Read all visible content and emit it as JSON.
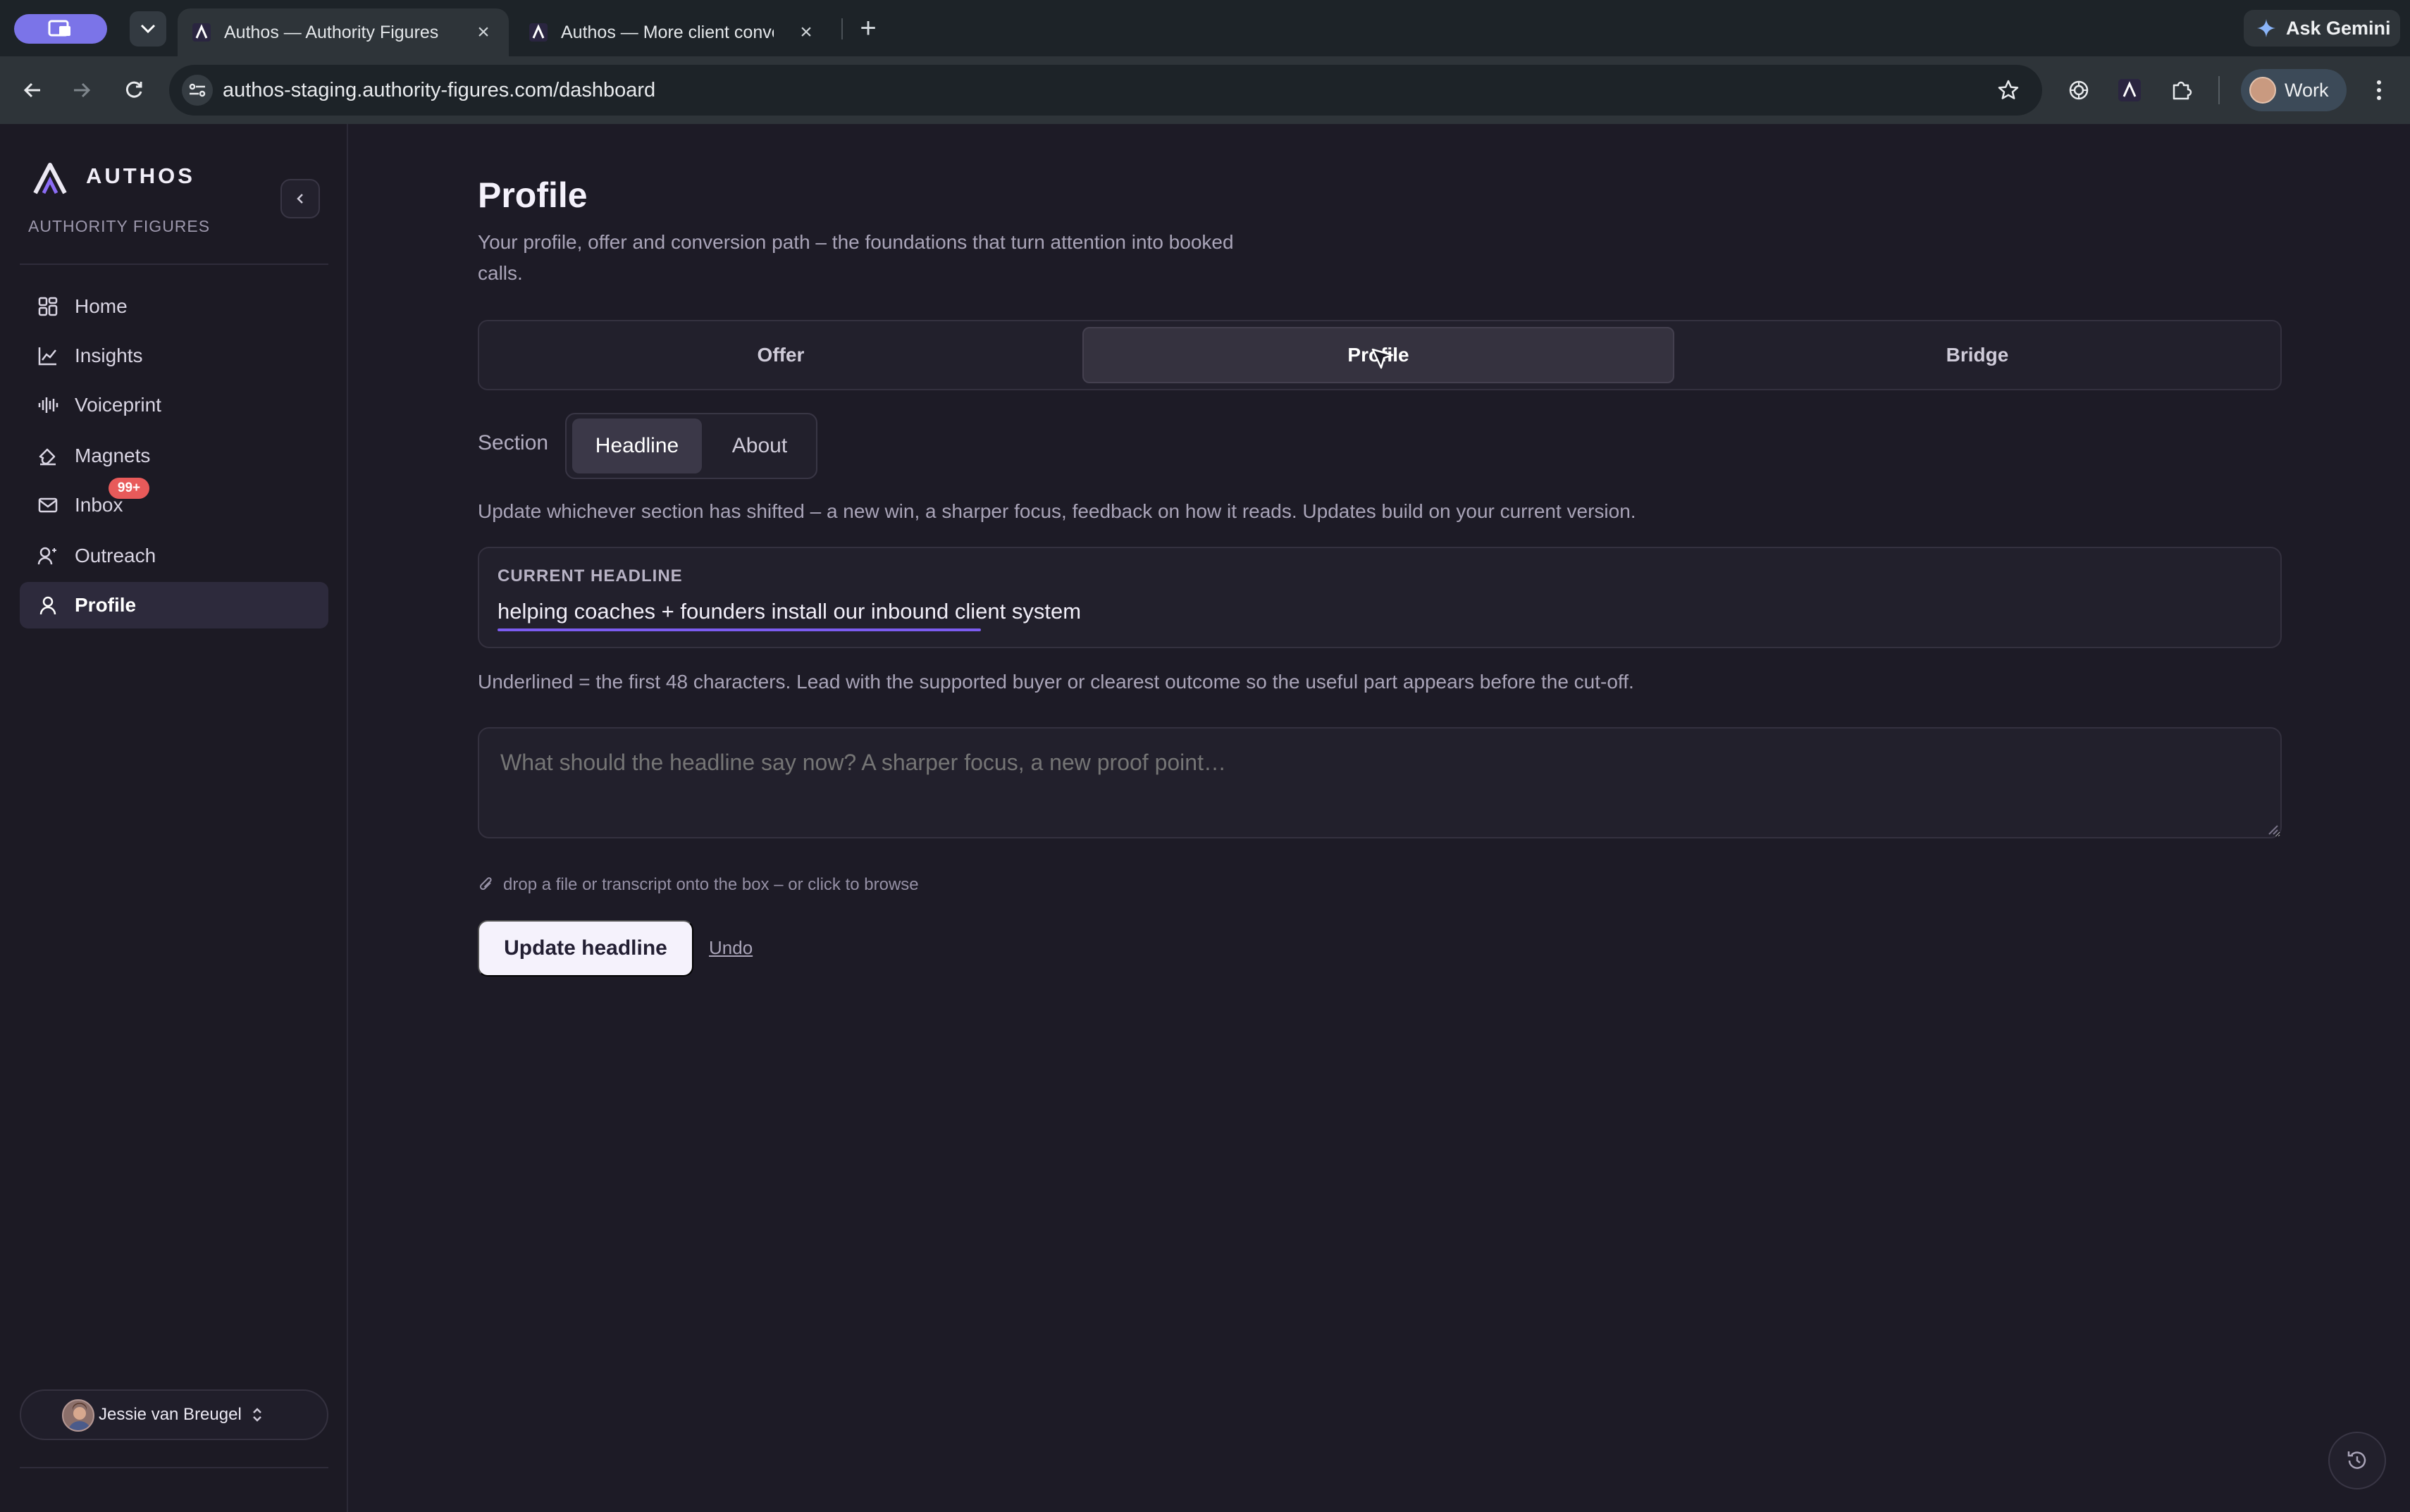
{
  "browser": {
    "tabs": [
      {
        "title": "Authos — Authority Figures",
        "active": true
      },
      {
        "title": "Authos — More client convers",
        "active": false
      }
    ],
    "new_tab": "+",
    "ask_gemini": "Ask Gemini",
    "url": "authos-staging.authority-figures.com/dashboard",
    "profile_label": "Work"
  },
  "sidebar": {
    "brand": "AUTHOS",
    "workspace": "AUTHORITY FIGURES",
    "items": [
      {
        "label": "Home",
        "icon": "grid-icon"
      },
      {
        "label": "Insights",
        "icon": "chart-line-icon"
      },
      {
        "label": "Voiceprint",
        "icon": "waveform-icon"
      },
      {
        "label": "Magnets",
        "icon": "magnet-icon"
      },
      {
        "label": "Inbox",
        "icon": "mail-icon",
        "badge": "99+"
      },
      {
        "label": "Outreach",
        "icon": "user-plus-icon"
      },
      {
        "label": "Profile",
        "icon": "user-icon",
        "active": true
      }
    ],
    "user": "Jessie van Breugel"
  },
  "main": {
    "title": "Profile",
    "subtitle": "Your profile, offer and conversion path – the foundations that turn attention into booked calls.",
    "tabs": [
      {
        "label": "Offer"
      },
      {
        "label": "Profile",
        "active": true
      },
      {
        "label": "Bridge"
      }
    ],
    "section_label": "Section",
    "sections": [
      {
        "label": "Headline",
        "active": true
      },
      {
        "label": "About"
      }
    ],
    "help": "Update whichever section has shifted – a new win, a sharper focus, feedback on how it reads. Updates build on your current version.",
    "current_label": "CURRENT HEADLINE",
    "current_value": "helping coaches + founders install our inbound client system",
    "note": "Underlined = the first 48 characters. Lead with the supported buyer or clearest outcome so the useful part appears before the cut-off.",
    "input_placeholder": "What should the headline say now? A sharper focus, a new proof point…",
    "drop_hint": "drop a file or transcript onto the box – or click to browse",
    "primary_button": "Update headline",
    "undo": "Undo"
  },
  "colors": {
    "accent": "#7c5cf0",
    "badge": "#e85a5a",
    "background": "#1d1b26"
  }
}
